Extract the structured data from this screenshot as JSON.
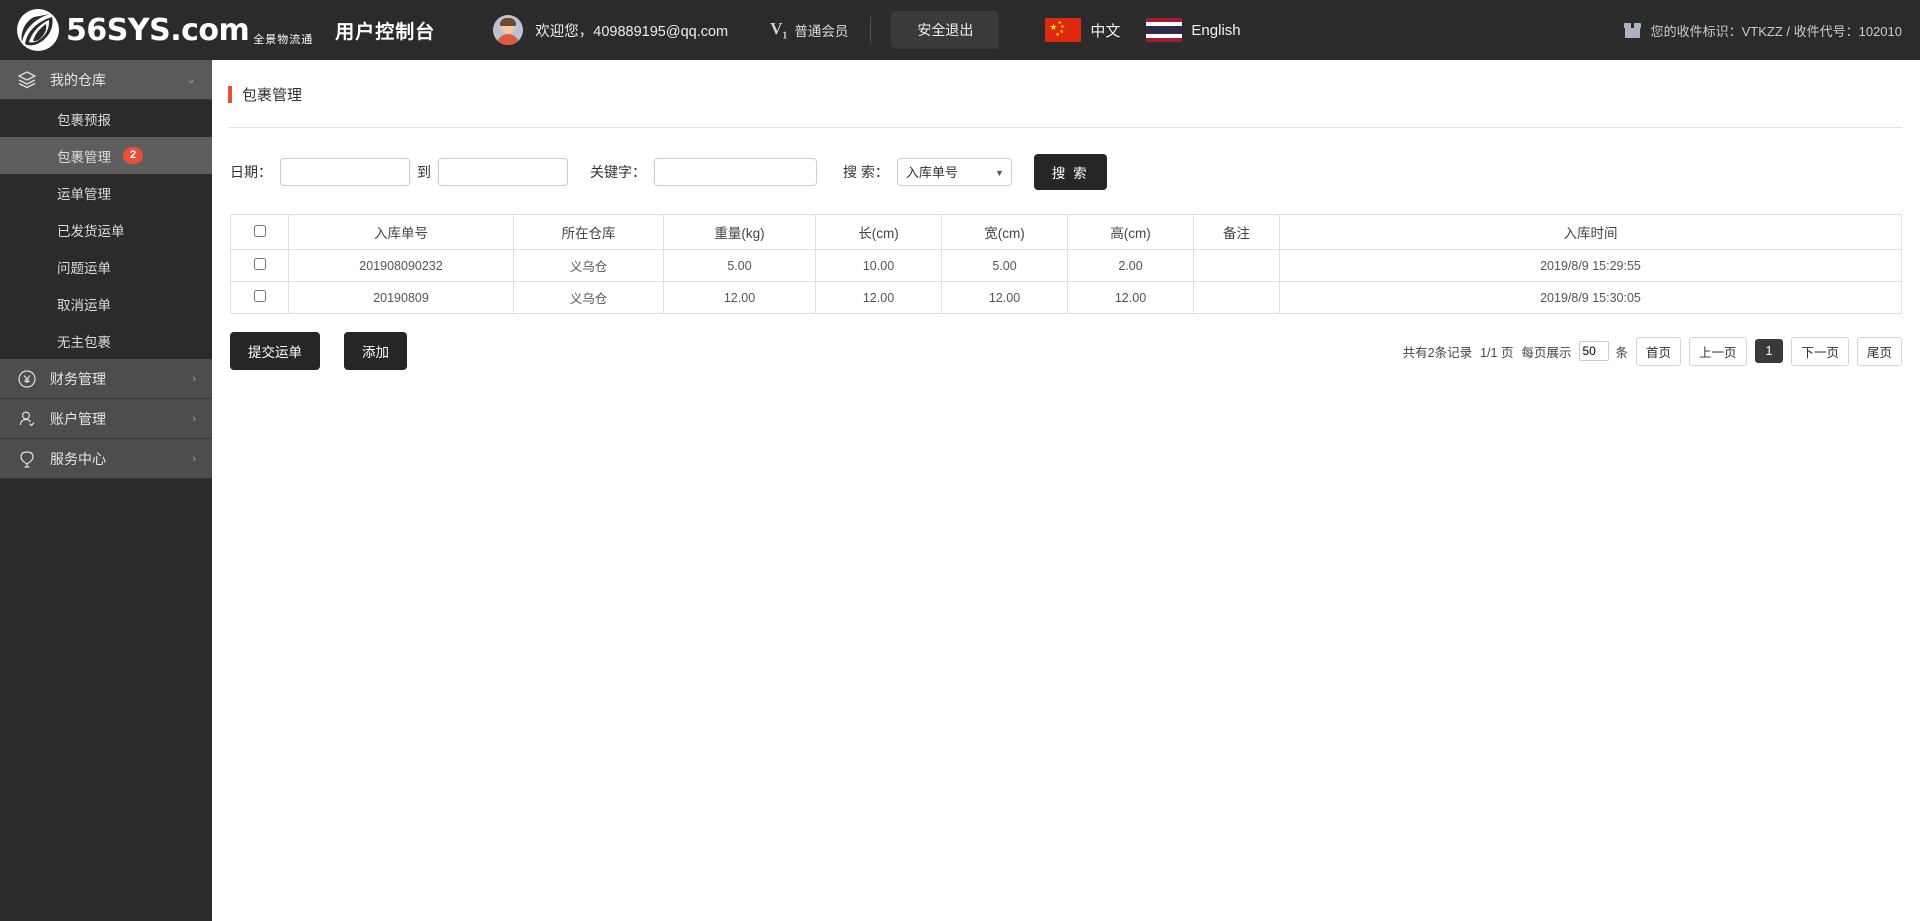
{
  "header": {
    "logo_main": "56SYS",
    "logo_domain": ".com",
    "logo_sub_line1": "全景物流通",
    "console_title": "用户控制台",
    "welcome": "欢迎您，409889195@qq.com",
    "vip_badge": "V",
    "vip_badge_sub": "1",
    "vip_level": "普通会员",
    "logout_label": "安全退出",
    "lang_cn": "中文",
    "lang_en": "English",
    "recv_info": "您的收件标识：VTKZZ / 收件代号：102010"
  },
  "sidebar": {
    "groups": [
      {
        "label": "我的仓库",
        "icon": "layers-icon",
        "open": true,
        "items": [
          {
            "label": "包裹预报",
            "badge": "",
            "active": false
          },
          {
            "label": "包裹管理",
            "badge": "2",
            "active": true
          },
          {
            "label": "运单管理",
            "badge": "",
            "active": false
          },
          {
            "label": "已发货运单",
            "badge": "",
            "active": false
          },
          {
            "label": "问题运单",
            "badge": "",
            "active": false
          },
          {
            "label": "取消运单",
            "badge": "",
            "active": false
          },
          {
            "label": "无主包裹",
            "badge": "",
            "active": false
          }
        ]
      },
      {
        "label": "财务管理",
        "icon": "yen-circle-icon",
        "open": false,
        "items": []
      },
      {
        "label": "账户管理",
        "icon": "user-icon",
        "open": false,
        "items": []
      },
      {
        "label": "服务中心",
        "icon": "support-icon",
        "open": false,
        "items": []
      }
    ]
  },
  "page": {
    "title": "包裹管理"
  },
  "search": {
    "date_label": "日期：",
    "date_from": "",
    "date_to": "",
    "between_label": "到",
    "keyword_label": "关键字：",
    "keyword_value": "",
    "search_select_label": "搜 索：",
    "search_select_value": "入库单号",
    "search_select_options": [
      "入库单号"
    ],
    "search_button": "搜 索"
  },
  "table": {
    "headers": [
      "",
      "入库单号",
      "所在仓库",
      "重量(kg)",
      "长(cm)",
      "宽(cm)",
      "高(cm)",
      "备注",
      "入库时间"
    ],
    "rows": [
      {
        "order_no": "201908090232",
        "warehouse": "义乌仓",
        "weight": "5.00",
        "length": "10.00",
        "width": "5.00",
        "height": "2.00",
        "remark": "",
        "time": "2019/8/9 15:29:55"
      },
      {
        "order_no": "20190809",
        "warehouse": "义乌仓",
        "weight": "12.00",
        "length": "12.00",
        "width": "12.00",
        "height": "12.00",
        "remark": "",
        "time": "2019/8/9 15:30:05"
      }
    ]
  },
  "actions": {
    "submit_label": "提交运单",
    "add_label": "添加"
  },
  "pagination": {
    "total_text": "共有2条记录",
    "page_text": "1/1 页",
    "per_page_label": "每页展示",
    "per_page_value": "50",
    "unit": "条",
    "first": "首页",
    "prev": "上一页",
    "current": "1",
    "next": "下一页",
    "last": "尾页"
  },
  "colors": {
    "accent": "#e8502a",
    "dark": "#2b2b2b",
    "badge": "#e8503a"
  }
}
